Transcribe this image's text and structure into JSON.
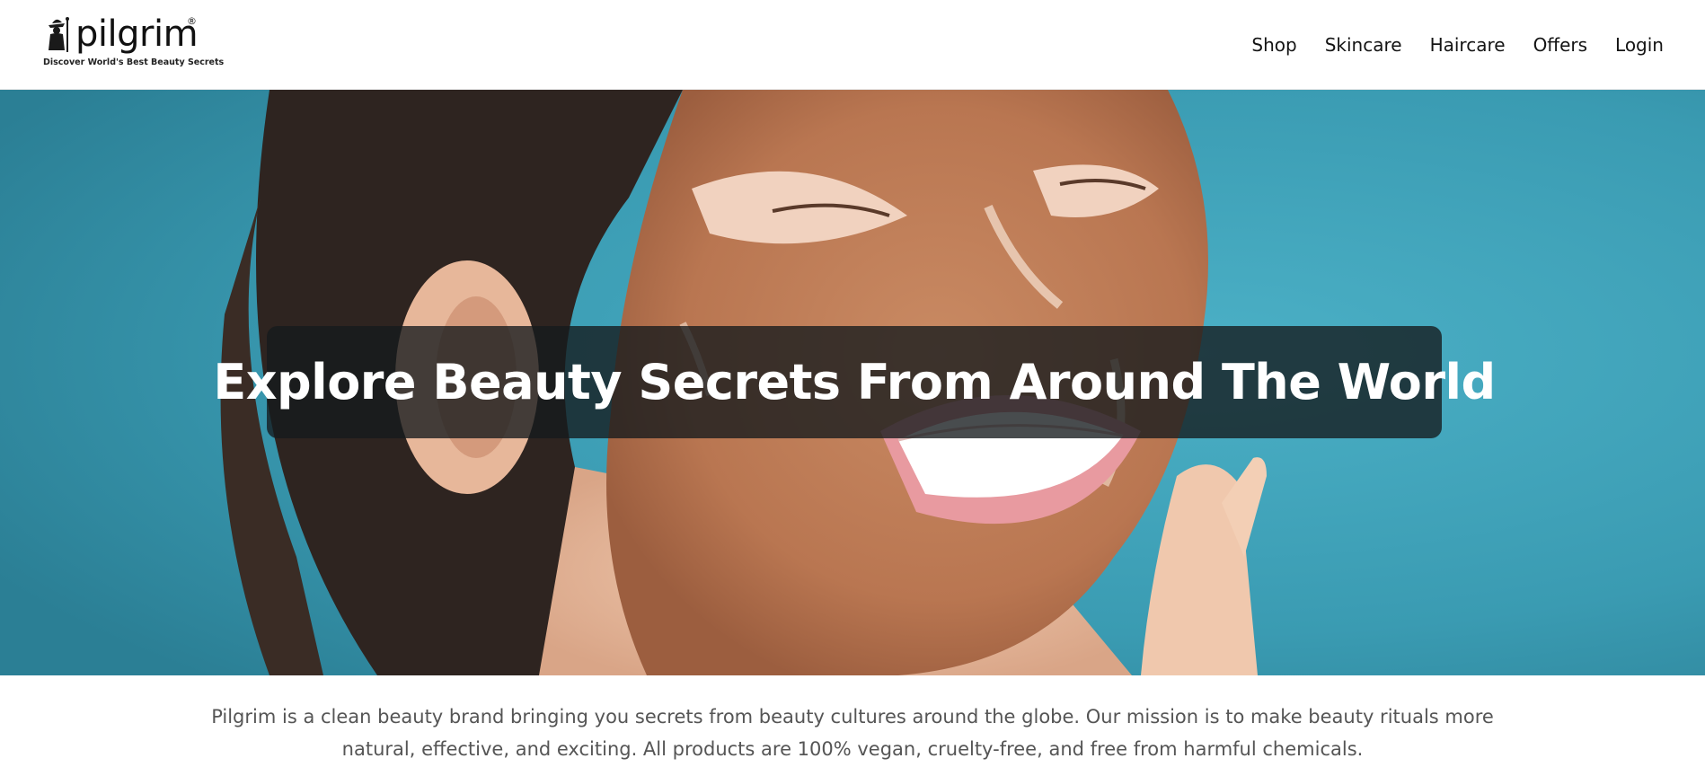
{
  "brand": {
    "name": "pilgrim",
    "registered_mark": "®",
    "tagline": "Discover World's Best Beauty Secrets",
    "logo_icon": "pilgrim-wanderer-icon"
  },
  "nav": {
    "items": [
      {
        "label": "Shop"
      },
      {
        "label": "Skincare"
      },
      {
        "label": "Haircare"
      },
      {
        "label": "Offers"
      },
      {
        "label": "Login"
      }
    ]
  },
  "hero": {
    "title": "Explore Beauty Secrets From Around The World",
    "image": "woman-with-clay-face-mask-photo",
    "background_color": "#3a9bb2"
  },
  "description": {
    "text": "Pilgrim is a clean beauty brand bringing you secrets from beauty cultures around the globe. Our mission is to make beauty rituals more natural, effective, and exciting. All products are 100% vegan, cruelty-free, and free from harmful chemicals."
  },
  "colors": {
    "text_primary": "#141414",
    "text_body": "#555555",
    "banner_bg": "rgba(20,25,28,0.78)"
  }
}
